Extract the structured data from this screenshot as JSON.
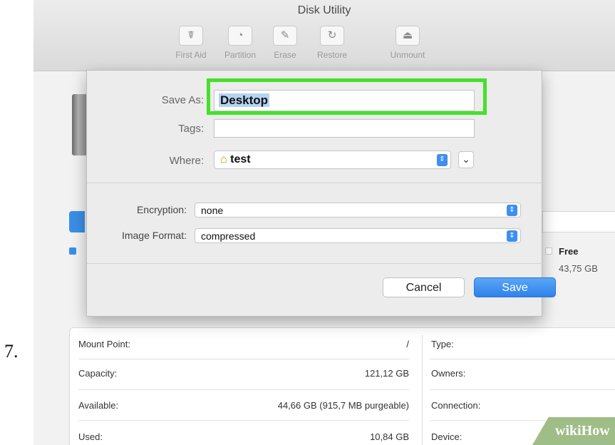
{
  "step_number": "7.",
  "window": {
    "title": "Disk Utility",
    "toolbar": [
      {
        "icon": "first-aid-icon",
        "glyph": "☤",
        "label": "First Aid"
      },
      {
        "icon": "partition-icon",
        "glyph": "◔",
        "label": "Partition"
      },
      {
        "icon": "erase-icon",
        "glyph": "✎",
        "label": "Erase"
      },
      {
        "icon": "restore-icon",
        "glyph": "↻",
        "label": "Restore"
      },
      {
        "icon": "unmount-icon",
        "glyph": "⏏",
        "label": "Unmount"
      }
    ]
  },
  "usage": {
    "free_label": "Free",
    "free_value": "43,75 GB"
  },
  "sheet": {
    "save_as_label": "Save As:",
    "save_as_value": "Desktop",
    "tags_label": "Tags:",
    "tags_value": "",
    "where_label": "Where:",
    "where_value": "test",
    "where_icon": "home-folder-icon",
    "encryption_label": "Encryption:",
    "encryption_value": "none",
    "image_format_label": "Image Format:",
    "image_format_value": "compressed",
    "cancel_label": "Cancel",
    "save_label": "Save",
    "stepper_glyph": "⇕",
    "expand_glyph": "⌄",
    "home_glyph": "⌂"
  },
  "info": {
    "left": [
      {
        "key": "Mount Point:",
        "value": "/"
      },
      {
        "key": "Capacity:",
        "value": "121,12 GB"
      },
      {
        "key": "Available:",
        "value": "44,66 GB (915,7 MB purgeable)"
      },
      {
        "key": "Used:",
        "value": "10,84 GB"
      }
    ],
    "right": [
      {
        "key": "Type:"
      },
      {
        "key": "Owners:"
      },
      {
        "key": "Connection:"
      },
      {
        "key": "Device:"
      }
    ]
  },
  "watermark": "wikiHow",
  "colors": {
    "accent_blue": "#3d8ff0",
    "highlight_green": "#46e02b",
    "watermark_green": "#9fbd86"
  }
}
